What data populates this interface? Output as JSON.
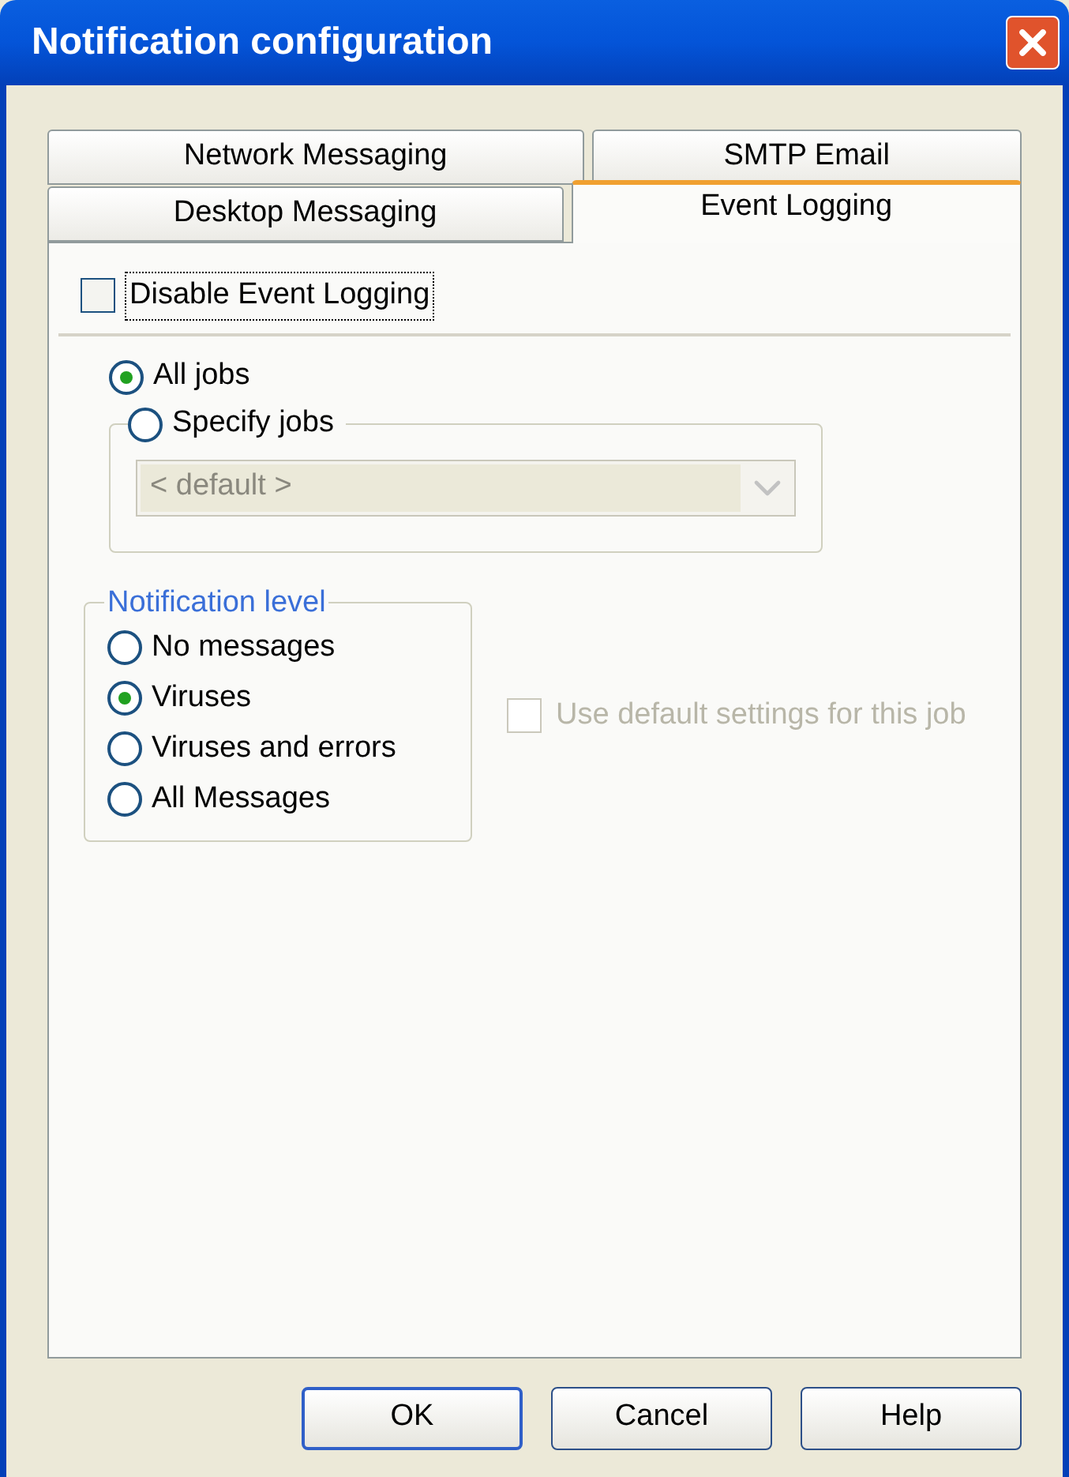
{
  "window": {
    "title": "Notification configuration"
  },
  "tab_rows": [
    [
      {
        "label": "Network Messaging",
        "selected": false
      },
      {
        "label": "SMTP Email",
        "selected": false
      }
    ],
    [
      {
        "label": "Desktop Messaging",
        "selected": false
      },
      {
        "label": "Event Logging",
        "selected": true
      }
    ]
  ],
  "disable_event_logging": {
    "label": "Disable Event Logging",
    "checked": false,
    "focused": true
  },
  "job_scope": [
    {
      "label": "All jobs",
      "selected": true
    },
    {
      "label": "Specify jobs",
      "selected": false
    }
  ],
  "job_dropdown": {
    "value": "< default >",
    "disabled": true
  },
  "notification_level": {
    "title": "Notification level",
    "options": [
      {
        "label": "No messages",
        "selected": false
      },
      {
        "label": "Viruses",
        "selected": true
      },
      {
        "label": "Viruses and errors",
        "selected": false
      },
      {
        "label": "All Messages",
        "selected": false
      }
    ]
  },
  "use_default_settings": {
    "label": "Use default settings for this job",
    "checked": false,
    "disabled": true
  },
  "buttons": [
    {
      "label": "OK",
      "default": true
    },
    {
      "label": "Cancel",
      "default": false
    },
    {
      "label": "Help",
      "default": false
    }
  ]
}
